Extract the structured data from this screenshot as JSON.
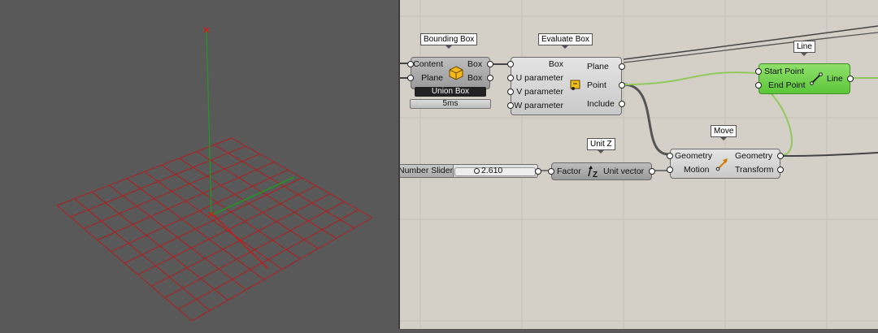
{
  "canvas": {
    "components": {
      "bounding_box": {
        "tag": "Bounding Box",
        "inputs": [
          "Content",
          "Plane"
        ],
        "outputs": [
          "Box",
          "Box"
        ],
        "option": "Union Box",
        "timing": "5ms",
        "icon": "box-cube-icon"
      },
      "evaluate_box": {
        "tag": "Evaluate Box",
        "inputs": [
          "Box",
          "U parameter",
          "V parameter",
          "W parameter"
        ],
        "outputs": [
          "Plane",
          "Point",
          "Include"
        ],
        "icon": "evaluate-box-icon"
      },
      "line": {
        "tag": "Line",
        "inputs": [
          "Start Point",
          "End Point"
        ],
        "outputs": [
          "Line"
        ],
        "icon": "line-icon"
      },
      "number_slider": {
        "label": "Number Slider",
        "value": "2.610"
      },
      "unit_z": {
        "tag": "Unit Z",
        "inputs": [
          "Factor"
        ],
        "outputs": [
          "Unit vector"
        ],
        "icon": "unit-z-icon"
      },
      "move": {
        "tag": "Move",
        "inputs": [
          "Geometry",
          "Motion"
        ],
        "outputs": [
          "Geometry",
          "Transform"
        ],
        "icon": "move-arrow-icon"
      }
    },
    "colors": {
      "canvas_bg": "#d4d0c8",
      "viewport_bg": "#595959",
      "grid_red": "#b01e1e",
      "axis_green": "#1d9b1d",
      "wire_selected": "#8bc34a",
      "component_selected": "#6fd24a"
    }
  }
}
